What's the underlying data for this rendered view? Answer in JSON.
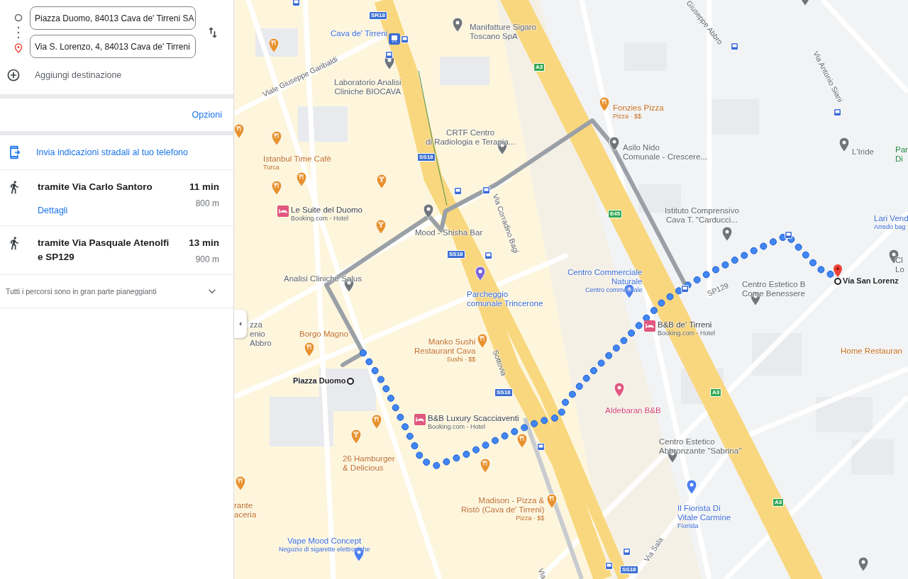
{
  "directions": {
    "origin": {
      "value": "Piazza Duomo, 84013 Cava de' Tirreni SA"
    },
    "destination": {
      "value": "Via S. Lorenzo, 4, 84013 Cava de' Tirreni"
    },
    "add_stop": {
      "placeholder": "Aggiungi destinazione"
    }
  },
  "options_link": "Opzioni",
  "send_to_phone": "Invia indicazioni stradali al tuo telefono",
  "routes": [
    {
      "via": "tramite Via Carlo Santoro",
      "time": "11 min",
      "distance": "800 m",
      "details": "Dettagli"
    },
    {
      "via": "tramite Via Pasquale Atenolfi e SP129",
      "time": "13 min",
      "distance": "900 m"
    }
  ],
  "terrain_note": "Tutti i percorsi sono in gran parte pianeggianti",
  "map": {
    "labels": [
      {
        "kind": "transit",
        "lines": [
          "Cava de' Tirreni"
        ]
      },
      {
        "kind": "place",
        "lines": [
          "Manifatture Sigaro",
          "Toscano SpA"
        ]
      },
      {
        "kind": "place",
        "lines": [
          "Laboratorio Analisi",
          "Cliniche BIOCAVA"
        ]
      },
      {
        "kind": "street",
        "lines": [
          "Viale Giuseppe Garibaldi"
        ]
      },
      {
        "kind": "place",
        "lines": [
          "CRTF Centro",
          "di Radiologia e Terapia..."
        ]
      },
      {
        "kind": "restaurant",
        "lines": [
          "Istanbul Time Cafè"
        ],
        "sub": "Turca"
      },
      {
        "kind": "hotel",
        "lines": [
          "Le Suite del Duomo"
        ],
        "sub": "Booking.com - Hotel"
      },
      {
        "kind": "place",
        "lines": [
          "Mood - Shisha Bar"
        ]
      },
      {
        "kind": "street",
        "lines": [
          "Via Corradino Bagi"
        ]
      },
      {
        "kind": "place",
        "lines": [
          "Analisi Cliniche Salus"
        ]
      },
      {
        "kind": "transit",
        "lines": [
          "Parcheggio",
          "comunale Trincerone"
        ]
      },
      {
        "kind": "restaurant",
        "lines": [
          "Fonzies Pizza"
        ],
        "sub": "Pizza · $$"
      },
      {
        "kind": "place",
        "lines": [
          "Asilo Nido",
          "Comunale - Crescere..."
        ]
      },
      {
        "kind": "street",
        "lines": [
          "Giuseppe Abbro"
        ]
      },
      {
        "kind": "street",
        "lines": [
          "Via Antonio Siani"
        ]
      },
      {
        "kind": "place",
        "lines": [
          "L'Iride"
        ]
      },
      {
        "kind": "park",
        "lines": [
          "Par",
          "Di"
        ]
      },
      {
        "kind": "place",
        "lines": [
          "Istituto Comprensivo",
          "Cava T. \"Carducci..."
        ]
      },
      {
        "kind": "transit",
        "lines": [
          "Lari Vend"
        ],
        "sub": "Arredo bag"
      },
      {
        "kind": "street",
        "lines": [
          "SP129"
        ]
      },
      {
        "kind": "transit",
        "lines": [
          "Centro Commerciale",
          "Naturale"
        ],
        "sub": "Centro commerciale"
      },
      {
        "kind": "place",
        "lines": [
          "Centro Estetico B",
          "Come Benessere"
        ]
      },
      {
        "kind": "place",
        "lines": [
          "Cl",
          "Lo"
        ]
      },
      {
        "kind": "endpoint",
        "lines": [
          "Via San Lorenz"
        ]
      },
      {
        "kind": "restaurant",
        "lines": [
          "Home Restauran"
        ]
      },
      {
        "kind": "place",
        "lines": [
          "zza",
          "enio",
          "Abbro"
        ]
      },
      {
        "kind": "restaurant",
        "lines": [
          "Borgo Magno"
        ]
      },
      {
        "kind": "restaurant",
        "lines": [
          "Manko Sushi",
          "Restaurant Cava"
        ],
        "sub": "Sushi · $$"
      },
      {
        "kind": "street",
        "lines": [
          "Sottovia"
        ]
      },
      {
        "kind": "hotel",
        "lines": [
          "B&B de' Tirreni"
        ],
        "sub": "Booking.com - Hotel"
      },
      {
        "kind": "endpoint",
        "lines": [
          "Piazza Duomo"
        ]
      },
      {
        "kind": "lodging",
        "lines": [
          "Aldebaran B&B"
        ]
      },
      {
        "kind": "hotel",
        "lines": [
          "B&B Luxury Scacciaventi"
        ],
        "sub": "Booking.com - Hotel"
      },
      {
        "kind": "place",
        "lines": [
          "Centro Estetico",
          "Abbronzante \"Sabrina\""
        ]
      },
      {
        "kind": "restaurant",
        "lines": [
          "26 Hamburger",
          "& Delicious"
        ]
      },
      {
        "kind": "restaurant",
        "lines": [
          "rante",
          "aceria"
        ]
      },
      {
        "kind": "restaurant",
        "lines": [
          "Madison - Pizza &",
          "Ristò (Cava de' Tirreni)"
        ],
        "sub": "Pizza · $$"
      },
      {
        "kind": "transit",
        "lines": [
          "Il Fiorista Di",
          "Vitale Carmine"
        ],
        "sub": "Fiorista"
      },
      {
        "kind": "transit",
        "lines": [
          "Vape Mood Concept"
        ],
        "sub": "Negozio di sigarette elettroniche"
      },
      {
        "kind": "street",
        "lines": [
          "Via Sala"
        ]
      },
      {
        "kind": "street",
        "lines": [
          "Via"
        ]
      }
    ],
    "road_shields": [
      {
        "text": "SR18",
        "color": "#3c6fd1"
      },
      {
        "text": "SS18",
        "color": "#3c6fd1"
      },
      {
        "text": "SS18",
        "color": "#3c6fd1"
      },
      {
        "text": "SS18",
        "color": "#3c6fd1"
      },
      {
        "text": "SS18",
        "color": "#3c6fd1"
      },
      {
        "text": "A3",
        "color": "#34a853"
      },
      {
        "text": "E45",
        "color": "#34a853"
      },
      {
        "text": "A3",
        "color": "#34a853"
      },
      {
        "text": "A3",
        "color": "#34a853"
      }
    ]
  }
}
